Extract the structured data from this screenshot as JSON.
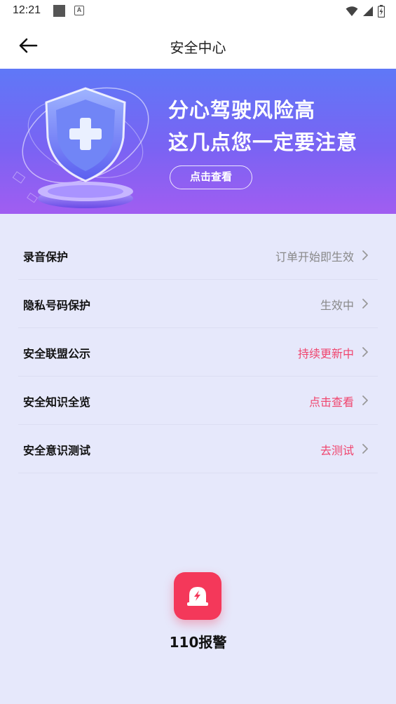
{
  "status_bar": {
    "time": "12:21"
  },
  "app_bar": {
    "title": "安全中心"
  },
  "banner": {
    "title_line1": "分心驾驶风险高",
    "title_line2": "这几点您一定要注意",
    "button_label": "点击查看"
  },
  "menu": {
    "items": [
      {
        "label": "录音保护",
        "value": "订单开始即生效",
        "value_color": "#888888"
      },
      {
        "label": "隐私号码保护",
        "value": "生效中",
        "value_color": "#888888"
      },
      {
        "label": "安全联盟公示",
        "value": "持续更新中",
        "value_color": "#f0456e"
      },
      {
        "label": "安全知识全览",
        "value": "点击查看",
        "value_color": "#f0456e"
      },
      {
        "label": "安全意识测试",
        "value": "去测试",
        "value_color": "#f0456e"
      }
    ]
  },
  "alarm": {
    "label": "110报警",
    "color": "#f4385a",
    "icon": "siren-icon"
  },
  "icons": {
    "back": "arrow-left-icon",
    "chevron": "chevron-right-icon",
    "wifi": "wifi-icon",
    "signal": "signal-icon",
    "battery": "battery-icon"
  }
}
